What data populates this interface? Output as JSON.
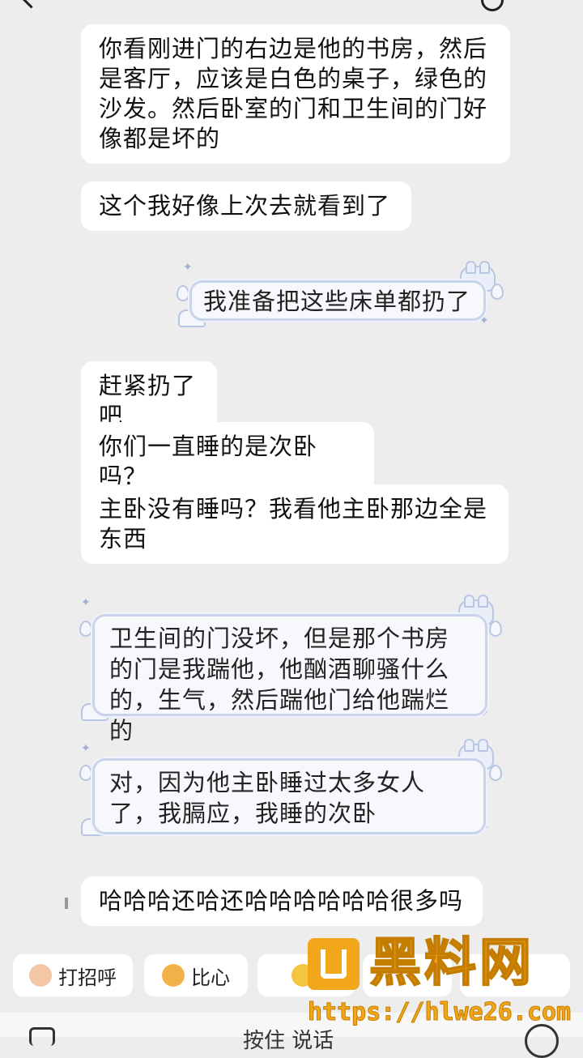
{
  "messages": [
    {
      "text": "你看刚进门的右边是他的书房，然后是客厅，应该是白色的桌子，绿色的沙发。然后卧室的门和卫生间的门好像都是坏的"
    },
    {
      "text": "这个我好像上次去就看到了"
    },
    {
      "text": "我准备把这些床单都扔了"
    },
    {
      "text": "赶紧扔了吧"
    },
    {
      "text": "你们一直睡的是次卧吗？"
    },
    {
      "text": "主卧没有睡吗？我看他主卧那边全是东西"
    },
    {
      "text": "卫生间的门没坏，但是那个书房的门是我踹他，他酗酒聊骚什么的，生气，然后踹他门给他踹烂的"
    },
    {
      "text": "对，因为他主卧睡过太多女人了，我膈应，我睡的次卧"
    },
    {
      "text": "哈哈哈还哈还哈哈哈哈哈哈很多吗"
    }
  ],
  "quick_replies": [
    "打招呼",
    "比心"
  ],
  "input_placeholder": "按住 说话",
  "watermark": {
    "title": "黑料网",
    "url": "https://hlwe26.com"
  }
}
